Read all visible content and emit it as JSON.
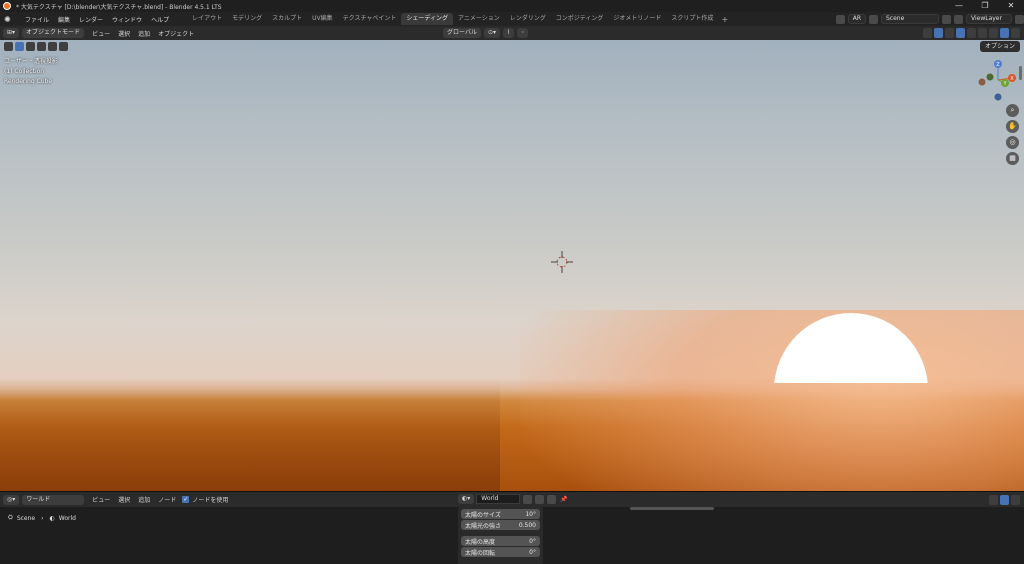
{
  "window": {
    "title": "* 大気テクスチャ [D:\\blender\\大気テクスチャ.blend] - Blender 4.5.1 LTS",
    "controls": [
      "—",
      "❐",
      "✕"
    ]
  },
  "menu": [
    "ファイル",
    "編集",
    "レンダー",
    "ウィンドウ",
    "ヘルプ"
  ],
  "workspaces": [
    {
      "label": "レイアウト",
      "active": false
    },
    {
      "label": "モデリング",
      "active": false
    },
    {
      "label": "スカルプト",
      "active": false
    },
    {
      "label": "UV編集",
      "active": false
    },
    {
      "label": "テクスチャペイント",
      "active": false
    },
    {
      "label": "シェーディング",
      "active": true
    },
    {
      "label": "アニメーション",
      "active": false
    },
    {
      "label": "レンダリング",
      "active": false
    },
    {
      "label": "コンポジティング",
      "active": false
    },
    {
      "label": "ジオメトリノード",
      "active": false
    },
    {
      "label": "スクリプト作成",
      "active": false
    }
  ],
  "workspace_add": "+",
  "topright": {
    "ar": "AR",
    "scene": "Scene",
    "view_layer": "ViewLayer"
  },
  "viewport_header": {
    "mode": "オブジェクトモード",
    "menus": [
      "ビュー",
      "選択",
      "追加",
      "オブジェクト"
    ],
    "transform_orientation": "グローバル",
    "options": "オプション"
  },
  "viewport_overlay": {
    "view": "ユーザー・透視投影",
    "collection": "(1) Collection",
    "object": "Rendering Cube"
  },
  "gizmo": {
    "x": "X",
    "y": "Y",
    "z": "Z"
  },
  "nav_icons": [
    "zoom-icon",
    "hand-icon",
    "camera-icon",
    "grid-icon"
  ],
  "shader_header": {
    "type": "ワールド",
    "menus": [
      "ビュー",
      "選択",
      "追加",
      "ノード"
    ],
    "use_nodes": "ノードを使用",
    "world": "World"
  },
  "breadcrumb": [
    "Scene",
    "World"
  ],
  "sky_props": [
    {
      "label": "太陽のサイズ",
      "value": "10°"
    },
    {
      "label": "太陽光の強さ",
      "value": "0.500"
    },
    {
      "label": "太陽の高度",
      "value": "0°"
    },
    {
      "label": "太陽の回転",
      "value": "0°"
    }
  ],
  "colors": {
    "accent": "#4772b3",
    "sky_top": "#a2b1be",
    "horizon": "#d1893f",
    "sun": "#ffffff"
  }
}
